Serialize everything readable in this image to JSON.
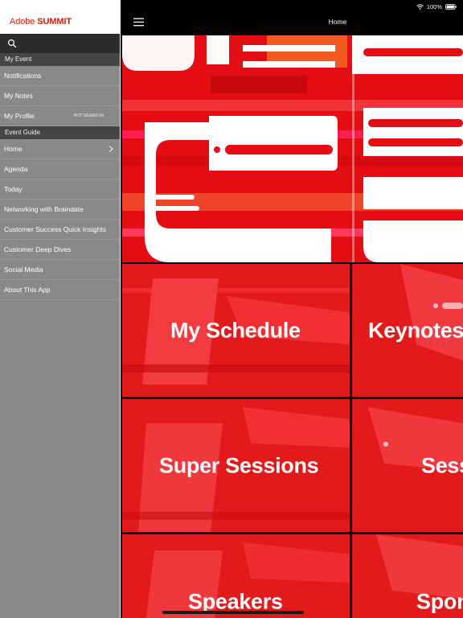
{
  "app": {
    "logo_regular": "Adobe ",
    "logo_bold": "SUMMIT",
    "brand_color": "#e3170a"
  },
  "status": {
    "battery": "100%"
  },
  "header": {
    "title": "Home"
  },
  "sidebar": {
    "my_event": {
      "title": "My Event",
      "items": [
        {
          "label": "Notifications"
        },
        {
          "label": "My Notes"
        },
        {
          "label": "My Profile",
          "badge": "NOT SIGNED IN"
        }
      ]
    },
    "event_guide": {
      "title": "Event Guide",
      "items": [
        {
          "label": "Home"
        },
        {
          "label": "Agenda"
        },
        {
          "label": "Today"
        },
        {
          "label": "Networking with Braindate"
        },
        {
          "label": "Customer Success Quick Insights"
        },
        {
          "label": "Customer Deep Dives"
        },
        {
          "label": "Social Media"
        },
        {
          "label": "About This App"
        }
      ]
    }
  },
  "tiles": [
    {
      "label": "My Schedule"
    },
    {
      "label": "Keynotes"
    },
    {
      "label": "Super Sessions"
    },
    {
      "label": "Sess"
    },
    {
      "label": "Speakers"
    },
    {
      "label": "Spon"
    }
  ],
  "icons": [
    "search-icon",
    "menu-icon",
    "chevron-right-icon",
    "wifi-icon",
    "battery-icon"
  ],
  "colors": {
    "tile_red": "#e31a1c",
    "sidebar_bg": "#898989",
    "section_header": "#454545"
  }
}
